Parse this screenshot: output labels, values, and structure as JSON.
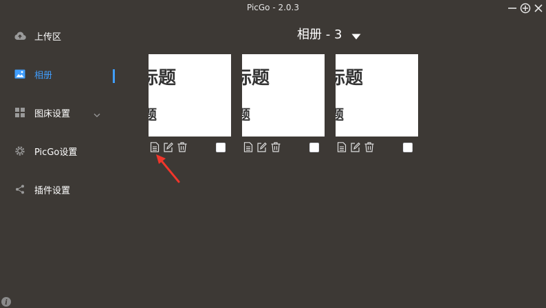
{
  "window": {
    "title": "PicGo - 2.0.3",
    "controls": [
      "minimize-icon",
      "pin-icon",
      "close-icon"
    ]
  },
  "sidebar": {
    "items": [
      {
        "label": "上传区",
        "icon": "cloud-upload-icon"
      },
      {
        "label": "相册",
        "icon": "image-icon",
        "active": true
      },
      {
        "label": "图床设置",
        "icon": "grid-icon",
        "has_submenu": true
      },
      {
        "label": "PicGo设置",
        "icon": "gear-icon"
      },
      {
        "label": "插件设置",
        "icon": "share-icon"
      }
    ],
    "accent_color": "#409eff"
  },
  "album": {
    "title": "相册 - 3",
    "cards": [
      {
        "line1": "标题",
        "line2": "题"
      },
      {
        "line1": "标题",
        "line2": "题"
      },
      {
        "line1": "标题",
        "line2": "题"
      }
    ]
  },
  "colors": {
    "background": "#3d3935",
    "annotation_arrow": "#f0362b"
  }
}
